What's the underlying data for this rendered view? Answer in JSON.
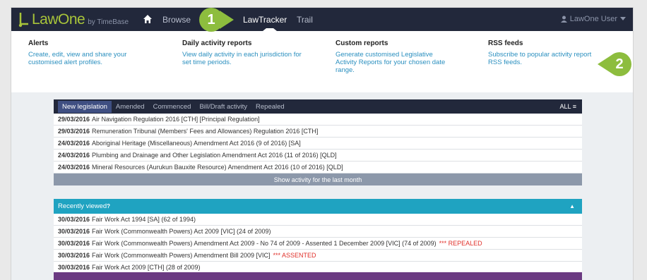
{
  "brand": {
    "name": "LawOne",
    "by": "by TimeBase"
  },
  "nav": {
    "items": [
      {
        "label": "Browse"
      },
      {
        "label": "LawTracker"
      },
      {
        "label": "Trail"
      }
    ],
    "active": "LawTracker"
  },
  "user": {
    "name": "LawOne User"
  },
  "submenu": {
    "columns": [
      {
        "title": "Alerts",
        "desc": "Create, edit, view and share your customised alert profiles."
      },
      {
        "title": "Daily activity reports",
        "desc": "View daily activity in each jurisdiction for set time periods."
      },
      {
        "title": "Custom reports",
        "desc": "Generate customised Legislative Activity Reports for your chosen date range."
      },
      {
        "title": "RSS feeds",
        "desc": "Subscribe to popular activity report RSS feeds."
      }
    ]
  },
  "markers": [
    {
      "label": "1"
    },
    {
      "label": "2"
    }
  ],
  "legislation": {
    "tabs": [
      "New legislation",
      "Amended",
      "Commenced",
      "Bill/Draft activity",
      "Repealed"
    ],
    "all_label": "ALL",
    "rows": [
      {
        "date": "29/03/2016",
        "text": "Air Navigation Regulation 2016 [CTH] [Principal Regulation]"
      },
      {
        "date": "29/03/2016",
        "text": "Remuneration Tribunal (Members' Fees and Allowances) Regulation 2016 [CTH]"
      },
      {
        "date": "24/03/2016",
        "text": "Aboriginal Heritage (Miscellaneous) Amendment Act 2016 (9 of 2016) [SA]"
      },
      {
        "date": "24/03/2016",
        "text": "Plumbing and Drainage and Other Legislation Amendment Act 2016 (11 of 2016) [QLD]"
      },
      {
        "date": "24/03/2016",
        "text": "Mineral Resources (Aurukun Bauxite Resource) Amendment Act 2016 (10 of 2016) [QLD]"
      }
    ],
    "show_more": "Show activity for the last month"
  },
  "recent": {
    "title": "Recently viewed",
    "help": "?",
    "rows": [
      {
        "date": "30/03/2016",
        "text": "Fair Work Act 1994 [SA] (62 of 1994)",
        "flag": ""
      },
      {
        "date": "30/03/2016",
        "text": "Fair Work (Commonwealth Powers) Act 2009 [VIC] (24 of 2009)",
        "flag": ""
      },
      {
        "date": "30/03/2016",
        "text": "Fair Work (Commonwealth Powers) Amendment Act 2009 - No 74 of 2009 - Assented 1 December 2009 [VIC] (74 of 2009)",
        "flag": "*** REPEALED"
      },
      {
        "date": "30/03/2016",
        "text": "Fair Work (Commonwealth Powers) Amendment Bill 2009 [VIC]",
        "flag": "*** ASSENTED"
      },
      {
        "date": "30/03/2016",
        "text": "Fair Work Act 2009 [CTH] (28 of 2009)",
        "flag": ""
      }
    ]
  },
  "colors": {
    "topbar": "#22283b",
    "accent_green": "#8dbd3e",
    "link_blue": "#2a8fbf",
    "recent_header": "#1fa3c1",
    "legislation_header": "#22283b",
    "bottom_panel": "#6b3a82",
    "alert_red": "#e0302a"
  }
}
